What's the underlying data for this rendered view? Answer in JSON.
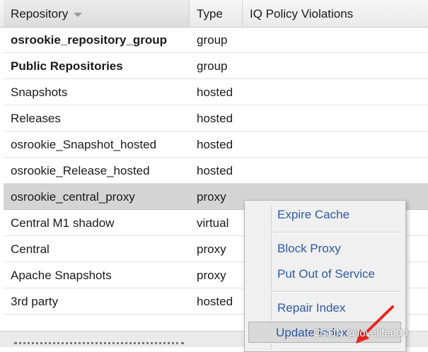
{
  "columns": {
    "repository": "Repository",
    "type": "Type",
    "iq_policy_violations": "IQ Policy Violations"
  },
  "rows": [
    {
      "name": "osrookie_repository_group",
      "type": "group",
      "bold": true
    },
    {
      "name": "Public Repositories",
      "type": "group",
      "bold": true
    },
    {
      "name": "Snapshots",
      "type": "hosted",
      "bold": false
    },
    {
      "name": "Releases",
      "type": "hosted",
      "bold": false
    },
    {
      "name": "osrookie_Snapshot_hosted",
      "type": "hosted",
      "bold": false
    },
    {
      "name": "osrookie_Release_hosted",
      "type": "hosted",
      "bold": false
    },
    {
      "name": "osrookie_central_proxy",
      "type": "proxy",
      "bold": false,
      "selected": true
    },
    {
      "name": "Central M1 shadow",
      "type": "virtual",
      "bold": false
    },
    {
      "name": "Central",
      "type": "proxy",
      "bold": false
    },
    {
      "name": "Apache Snapshots",
      "type": "proxy",
      "bold": false
    },
    {
      "name": "3rd party",
      "type": "hosted",
      "bold": false
    }
  ],
  "context_menu": {
    "expire_cache": "Expire Cache",
    "block_proxy": "Block Proxy",
    "put_out_of_service": "Put Out of Service",
    "repair_index": "Repair Index",
    "update_index": "Update Index"
  },
  "watermark": "CSDN @lovelife000",
  "colors": {
    "menu_link": "#2d5aa8",
    "selected_row": "#d4d4d4",
    "annotation_arrow": "#e8261e"
  },
  "icons": {
    "sort": "sort-descending-icon",
    "annotation": "red-arrow-icon"
  }
}
